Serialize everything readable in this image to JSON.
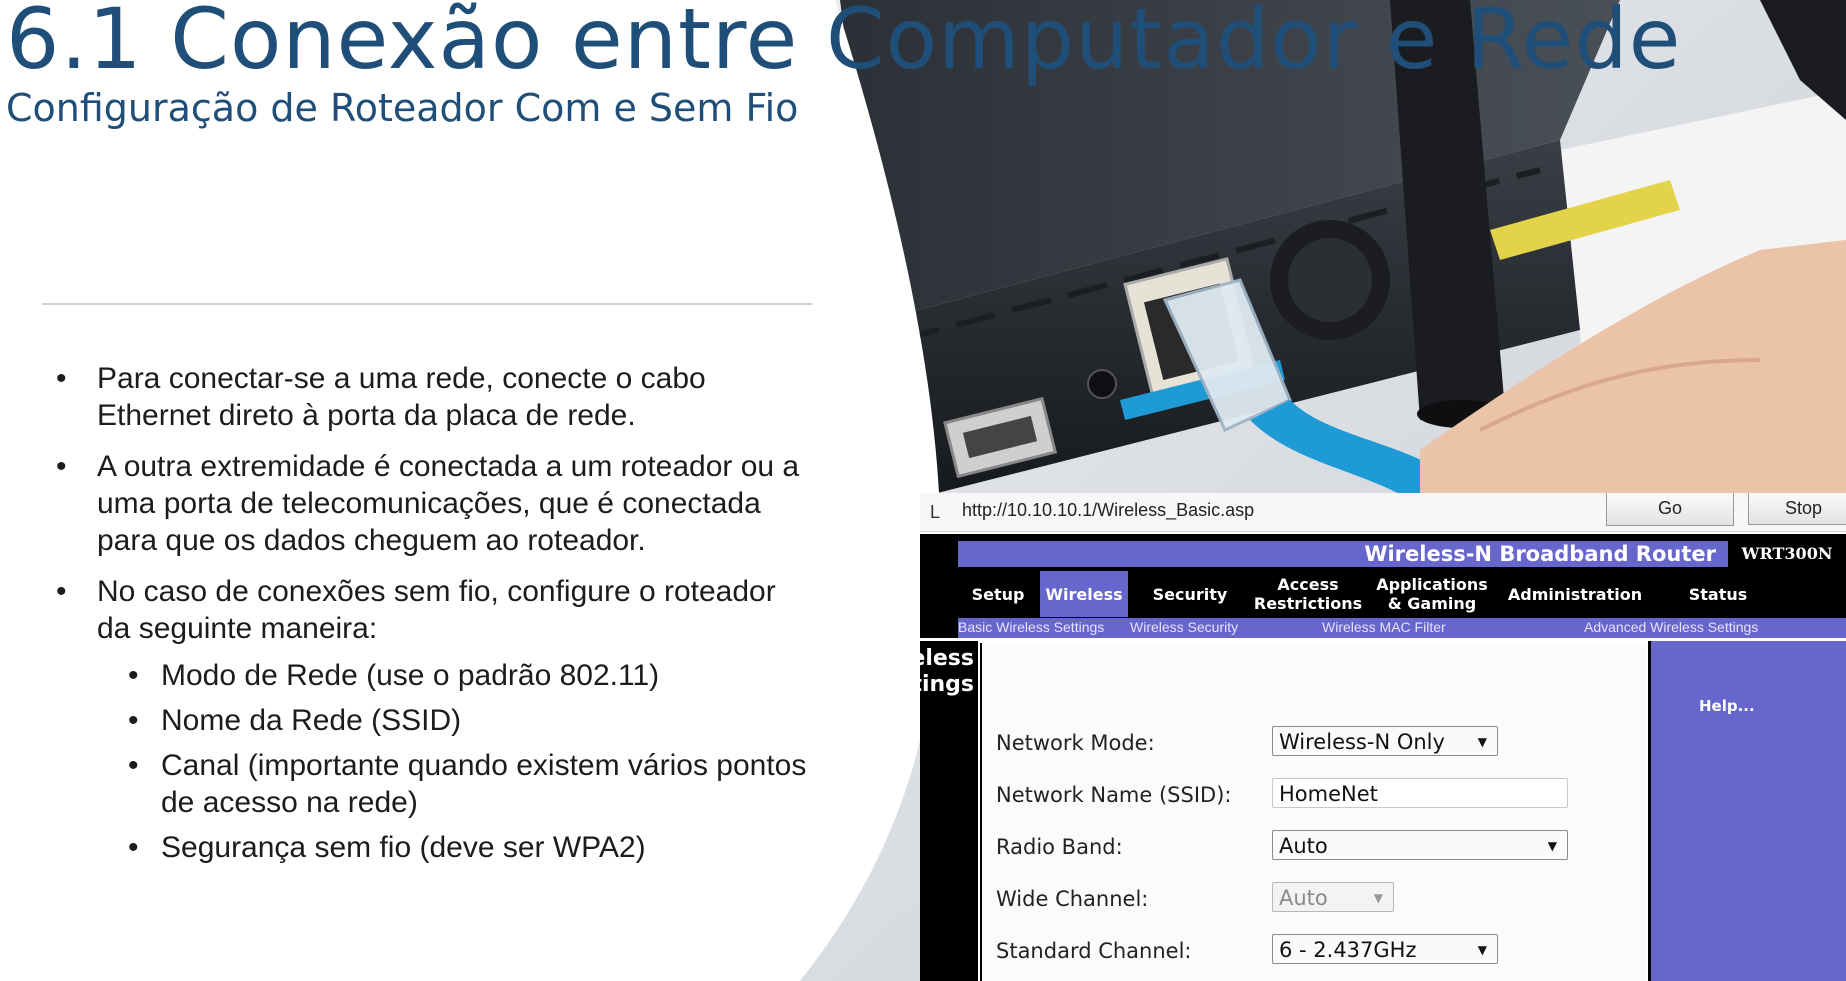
{
  "slide": {
    "title": "6.1 Conexão entre Computador e Rede",
    "subtitle": "Configuração de Roteador Com e Sem Fio",
    "bullets": [
      "Para conectar-se a uma rede, conecte o cabo Ethernet direto à porta da placa de rede.",
      "A outra extremidade é conectada a um roteador ou a uma porta de telecomunicações, que é conectada para que os dados cheguem ao roteador.",
      "No caso de conexões sem fio, configure o roteador da seguinte maneira:"
    ],
    "sub_bullets": [
      "Modo de Rede (use o padrão 802.11)",
      "Nome da Rede (SSID)",
      "Canal (importante quando existem vários pontos de acesso na rede)",
      "Segurança sem fio (deve ser WPA2)"
    ]
  },
  "router_ui": {
    "address_label": "L",
    "url": "http://10.10.10.1/Wireless_Basic.asp",
    "go_label": "Go",
    "stop_label": "Stop",
    "brand": "Wireless-N Broadband Router",
    "model": "WRT300N",
    "tabs": [
      "Setup",
      "Wireless",
      "Security",
      "Access Restrictions",
      "Applications & Gaming",
      "Administration",
      "Status"
    ],
    "active_tab": "Wireless",
    "subtabs": [
      "Basic Wireless Settings",
      "Wireless Security",
      "Wireless MAC Filter",
      "Advanced Wireless Settings"
    ],
    "side_title_1": "eless",
    "side_title_2": "tings",
    "help_label": "Help...",
    "fields": {
      "network_mode": {
        "label": "Network Mode:",
        "value": "Wireless-N Only"
      },
      "ssid": {
        "label": "Network Name (SSID):",
        "value": "HomeNet"
      },
      "radio_band": {
        "label": "Radio Band:",
        "value": "Auto"
      },
      "wide_channel": {
        "label": "Wide Channel:",
        "value": "Auto"
      },
      "standard_channel": {
        "label": "Standard Channel:",
        "value": "6 - 2.437GHz"
      }
    },
    "colors": {
      "nav_purple": "#6666cc",
      "header_black": "#000000"
    }
  },
  "colors": {
    "title": "#1f4e79",
    "cable": "#1e9ad6"
  },
  "icons": [
    "router-photo",
    "ethernet-cable-icon",
    "dropdown-arrow-icon"
  ]
}
